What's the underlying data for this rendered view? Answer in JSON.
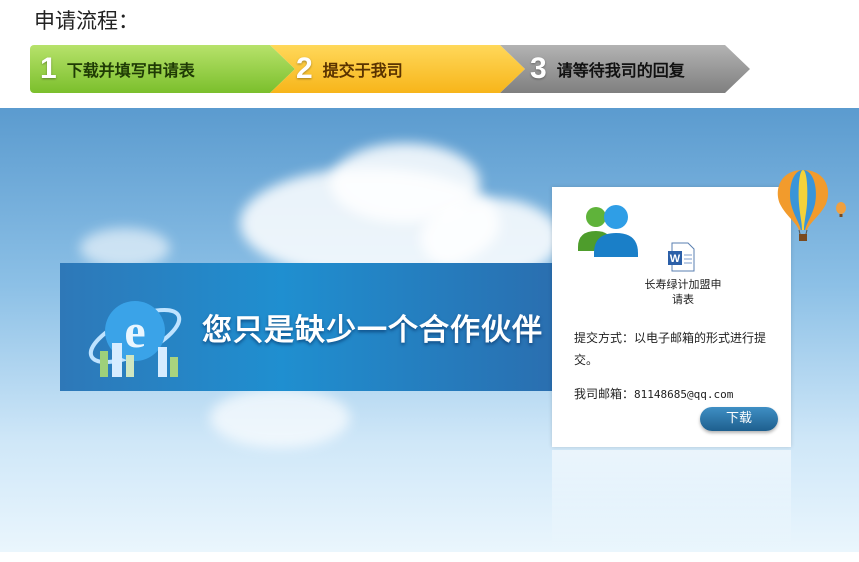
{
  "page": {
    "title": "申请流程："
  },
  "steps": [
    {
      "num": "1",
      "label": "下载并填写申请表"
    },
    {
      "num": "2",
      "label": "提交于我司"
    },
    {
      "num": "3",
      "label": "请等待我司的回复"
    }
  ],
  "banner": {
    "slogan": "您只是缺少一个合作伙伴"
  },
  "panel": {
    "doc_label": "长寿绿计加盟申请表",
    "submit_method": "提交方式：以电子邮箱的形式进行提交。",
    "email_label": "我司邮箱：",
    "email_value": "81148685@qq.com",
    "download_label": "下载"
  },
  "icons": [
    "users-icon",
    "word-document-icon",
    "ie-logo-icon",
    "hot-air-balloon-icon"
  ],
  "colors": {
    "step1": "#8cc63f",
    "step2": "#f9bc25",
    "step3": "#8c8c8c",
    "button": "#2a6fa3"
  }
}
